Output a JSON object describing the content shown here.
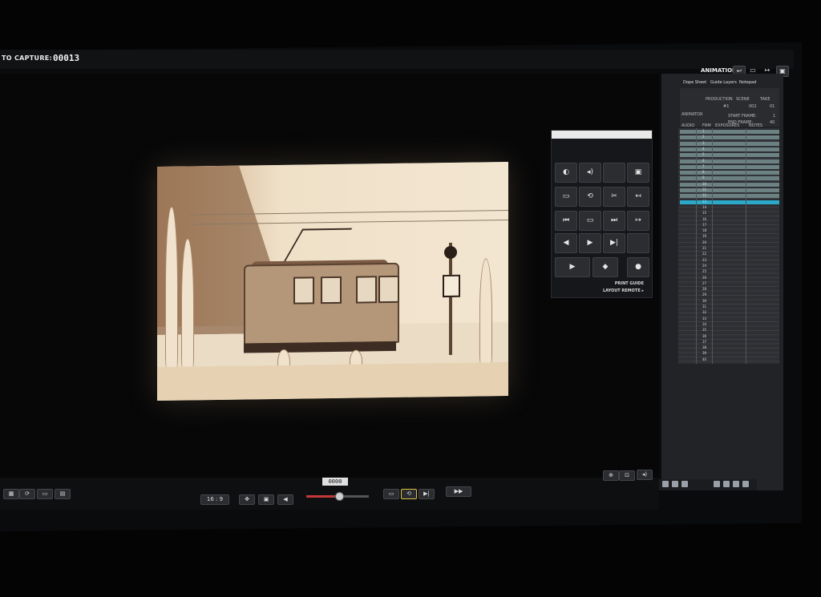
{
  "capture": {
    "label": "TO CAPTURE:",
    "count": "00013"
  },
  "mode": {
    "label": "ANIMATION"
  },
  "toolbar_icons": [
    "arrow-left-icon",
    "monitor-icon",
    "arrow-right-icon",
    "window-icon"
  ],
  "sheet": {
    "tabs": [
      "Dope Sheet",
      "Guide Layers",
      "Notepad"
    ],
    "header": {
      "production_label": "PRODUCTION",
      "scene_label": "SCENE",
      "take_label": "TAKE",
      "production": "#1",
      "scene": "002",
      "take": "01",
      "animator_label": "ANIMATOR",
      "start_frame_label": "START FRAME:",
      "start_frame": "1",
      "end_frame_label": "END FRAME:",
      "end_frame": "40"
    },
    "columns": [
      "AUDIO",
      "FRM",
      "EXPOSURES",
      "NOTES"
    ],
    "rows": [
      "1",
      "2",
      "3",
      "4",
      "5",
      "6",
      "7",
      "8",
      "9",
      "10",
      "11",
      "12",
      "13",
      "14",
      "15",
      "16",
      "17",
      "18",
      "19",
      "20",
      "21",
      "22",
      "23",
      "24",
      "25",
      "26",
      "27",
      "28",
      "29",
      "30",
      "31",
      "32",
      "33",
      "34",
      "35",
      "36",
      "37",
      "38",
      "39",
      "40"
    ],
    "highlighted_row": 13,
    "accent": "#2aa9c9",
    "marked_color": "#9fc2c1"
  },
  "panel": {
    "buttons": [
      {
        "icon": "onion-skin-icon",
        "glyph": "◐"
      },
      {
        "icon": "volume-icon",
        "glyph": "◂)"
      },
      {
        "icon": "blank-icon",
        "glyph": ""
      },
      {
        "icon": "camera-icon",
        "glyph": "▣"
      },
      {
        "icon": "toggle-icon",
        "glyph": "▭"
      },
      {
        "icon": "loop-icon",
        "glyph": "⟲"
      },
      {
        "icon": "scissors-icon",
        "glyph": "✂"
      },
      {
        "icon": "goto-start-icon",
        "glyph": "↤"
      },
      {
        "icon": "first-frame-icon",
        "glyph": "⏮"
      },
      {
        "icon": "screen-icon",
        "glyph": "▭"
      },
      {
        "icon": "last-frame-icon",
        "glyph": "⏭"
      },
      {
        "icon": "goto-end-icon",
        "glyph": "↦"
      },
      {
        "icon": "step-back-icon",
        "glyph": "◀"
      },
      {
        "icon": "step-forward-icon",
        "glyph": "▶"
      },
      {
        "icon": "skip-icon",
        "glyph": "▶|"
      },
      {
        "icon": "blank2-icon",
        "glyph": ""
      },
      {
        "icon": "play-icon",
        "glyph": "▶"
      },
      {
        "icon": "diamond-icon",
        "glyph": "◆"
      },
      {
        "icon": "record-icon",
        "glyph": "●"
      }
    ],
    "footer_line1": "PRINT GUIDE",
    "footer_line2": "LAYOUT   REMOTE ▸"
  },
  "timeline": {
    "frame": "0000"
  },
  "bottom": {
    "ratio": "16 : 9"
  }
}
